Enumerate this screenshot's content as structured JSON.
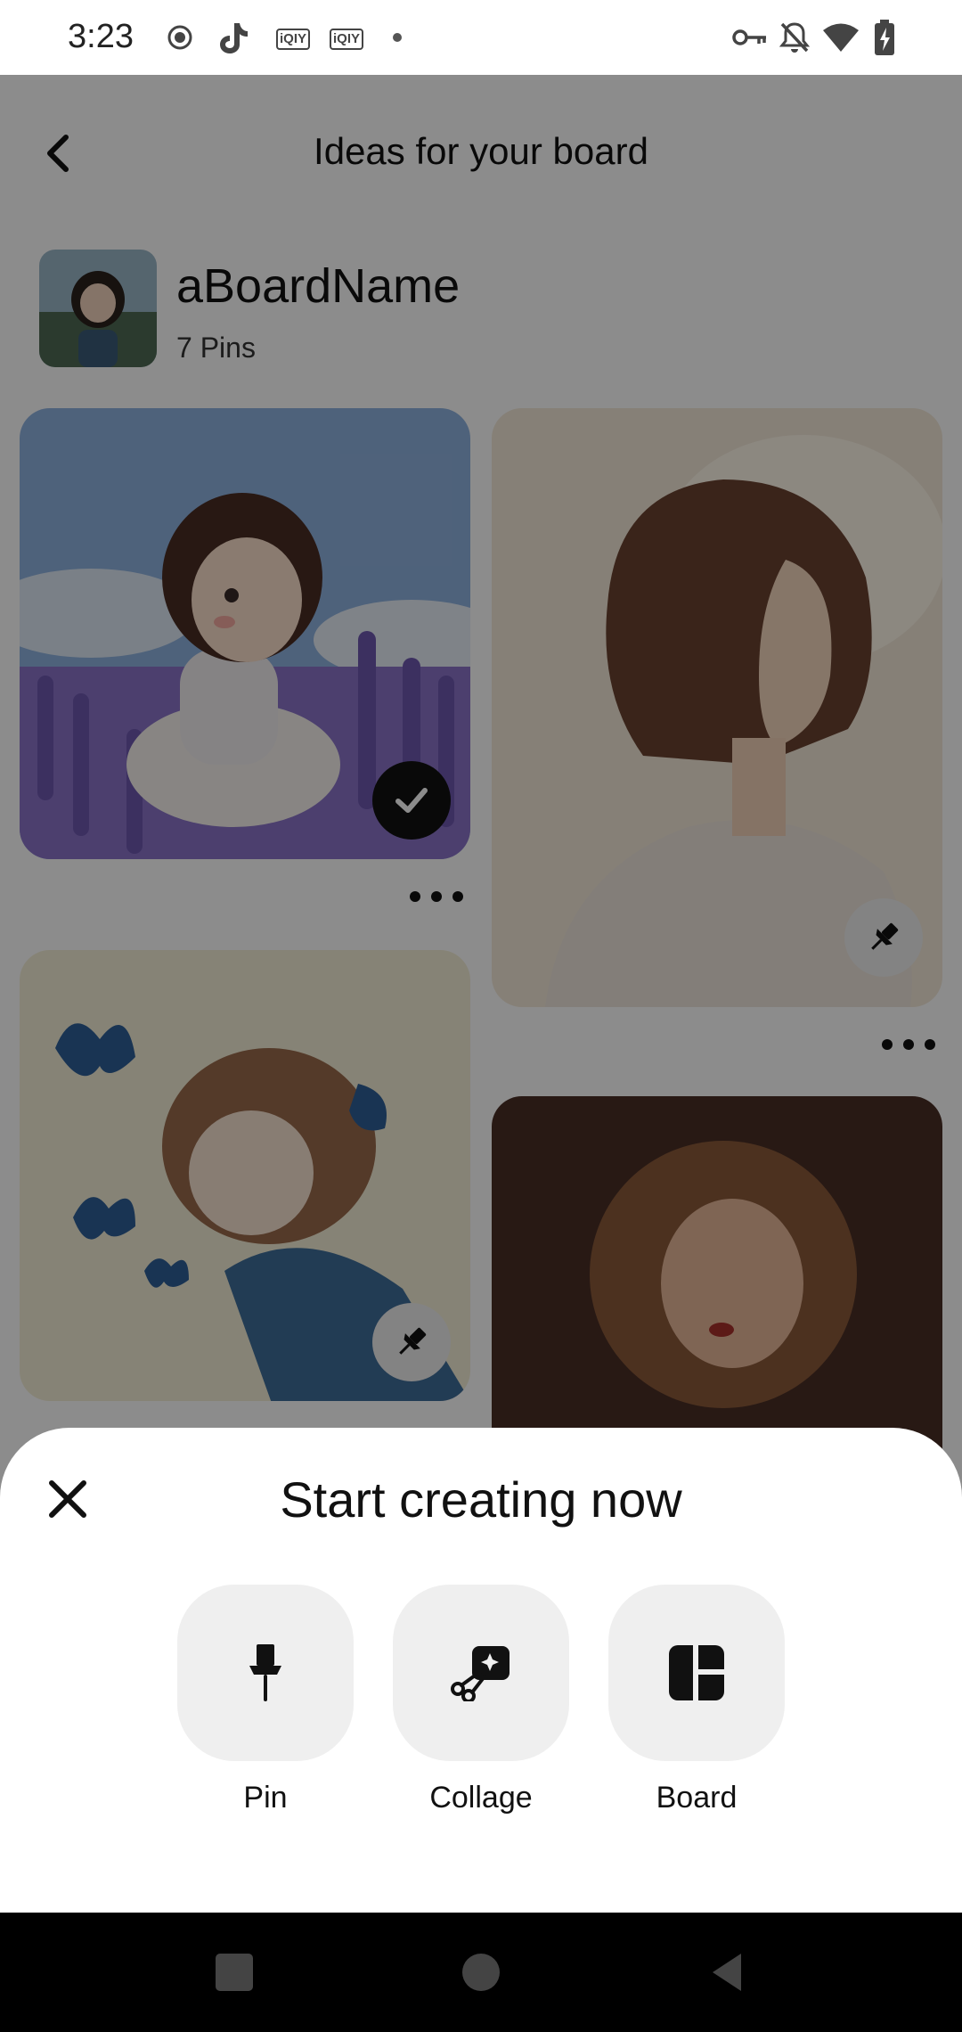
{
  "status_bar": {
    "time": "3:23",
    "left_icons": [
      "record-icon",
      "tiktok-icon",
      "iqiyi-icon",
      "iqiyi-icon",
      "dot-icon"
    ],
    "iqiyi_label": "iQIY",
    "right_icons": [
      "vpn-key-icon",
      "bell-off-icon",
      "wifi-icon",
      "battery-charging-icon"
    ]
  },
  "header": {
    "title": "Ideas for your board"
  },
  "board": {
    "name": "aBoardName",
    "pin_count": "7 Pins"
  },
  "pins": [
    {
      "id": "girl-lavender-field",
      "badge": "check-icon",
      "saved": true
    },
    {
      "id": "woman-profile-sunlight",
      "badge": "pushpin-icon",
      "saved": false
    },
    {
      "id": "girl-butterflies",
      "badge": "pushpin-icon",
      "saved": false
    },
    {
      "id": "woman-portrait-warm-light",
      "badge": "",
      "saved": false
    }
  ],
  "sheet": {
    "title": "Start creating now",
    "options": [
      {
        "label": "Pin",
        "icon": "pushpin-icon"
      },
      {
        "label": "Collage",
        "icon": "collage-scissors-icon"
      },
      {
        "label": "Board",
        "icon": "board-layout-icon"
      }
    ]
  },
  "nav_bar": {
    "buttons": [
      "recents-square-icon",
      "home-circle-icon",
      "back-triangle-icon"
    ]
  },
  "colors": {
    "sheet_background": "#ffffff",
    "tile_background": "#efefef",
    "scrim": "rgba(0,0,0,0.45)",
    "nav_background": "#000000"
  }
}
